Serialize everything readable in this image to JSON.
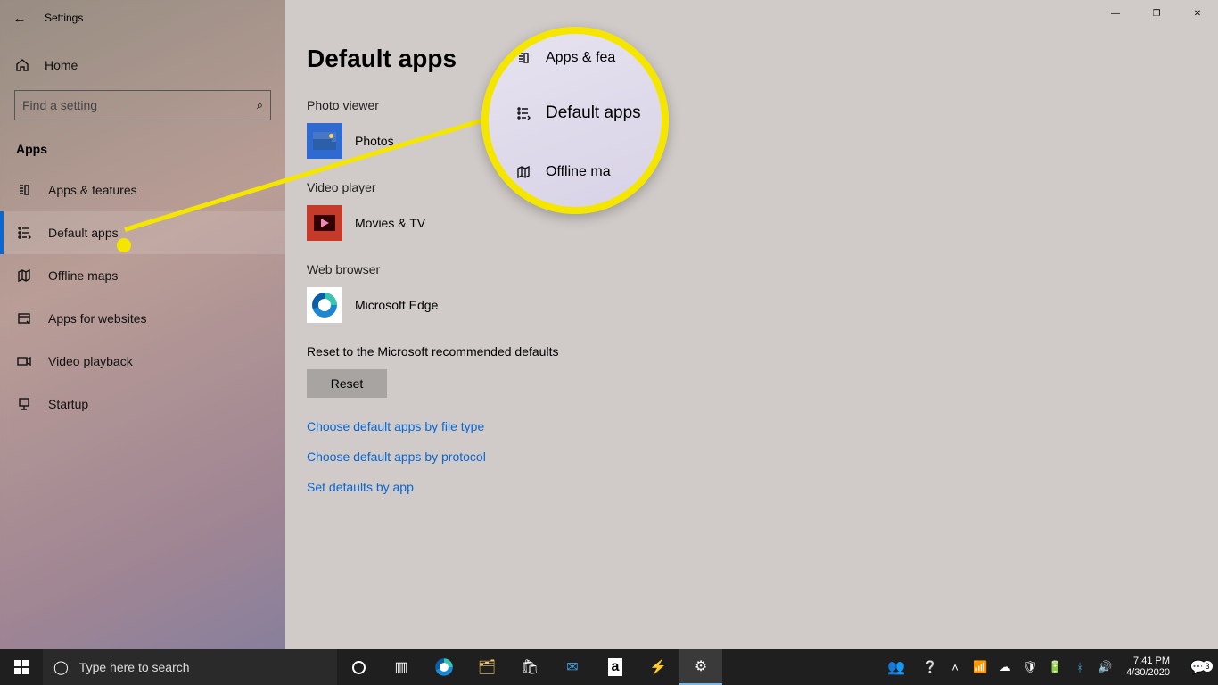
{
  "window": {
    "title": "Settings",
    "minimize": "—",
    "maximize": "❐",
    "close": "✕"
  },
  "sidebar": {
    "home": "Home",
    "search_placeholder": "Find a setting",
    "category": "Apps",
    "items": [
      {
        "label": "Apps & features"
      },
      {
        "label": "Default apps"
      },
      {
        "label": "Offline maps"
      },
      {
        "label": "Apps for websites"
      },
      {
        "label": "Video playback"
      },
      {
        "label": "Startup"
      }
    ]
  },
  "main": {
    "title": "Default apps",
    "sections": {
      "photo_viewer": {
        "title": "Photo viewer",
        "app": "Photos"
      },
      "video_player": {
        "title": "Video player",
        "app": "Movies & TV"
      },
      "web_browser": {
        "title": "Web browser",
        "app": "Microsoft Edge"
      }
    },
    "reset_header": "Reset to the Microsoft recommended defaults",
    "reset_button": "Reset",
    "links": {
      "by_filetype": "Choose default apps by file type",
      "by_protocol": "Choose default apps by protocol",
      "by_app": "Set defaults by app"
    }
  },
  "callout": {
    "row1": "Apps & fea",
    "row2": "Default apps",
    "row3": "Offline ma"
  },
  "taskbar": {
    "search_placeholder": "Type here to search",
    "time": "7:41 PM",
    "date": "4/30/2020",
    "notif_count": "3"
  }
}
